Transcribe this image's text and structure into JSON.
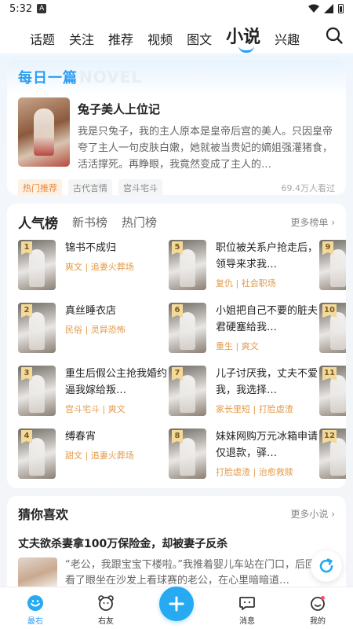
{
  "status": {
    "time": "5:32",
    "app_badge": "A"
  },
  "topnav": {
    "tabs": [
      {
        "label": "话题",
        "active": false
      },
      {
        "label": "关注",
        "active": false
      },
      {
        "label": "推荐",
        "active": false
      },
      {
        "label": "视频",
        "active": false
      },
      {
        "label": "图文",
        "active": false
      },
      {
        "label": "小说",
        "active": true
      },
      {
        "label": "兴趣",
        "active": false
      }
    ],
    "search_icon": "search-icon"
  },
  "daily": {
    "title": "每日一篇",
    "watermark": "NOVEL",
    "book_title": "兔子美人上位记",
    "description": "我是只兔子，我的主人原本是皇帝后宫的美人。只因皇帝夸了主人一句皮肤白嫩，她就被当贵妃的嫡姐强灌猪食，活活撑死。再睁眼，我竟然变成了主人的…",
    "tags": [
      "热门推荐",
      "古代言情",
      "宫斗宅斗"
    ],
    "reads": "69.4万人看过"
  },
  "rank": {
    "tabs": [
      {
        "label": "人气榜",
        "active": true
      },
      {
        "label": "新书榜",
        "active": false
      },
      {
        "label": "热门榜",
        "active": false
      }
    ],
    "more": "更多榜单 ›",
    "items": [
      {
        "num": "1",
        "title": "锦书不成归",
        "meta": "爽文 | 追妻火葬场"
      },
      {
        "num": "2",
        "title": "真丝睡衣店",
        "meta": "民俗 | 灵异恐怖"
      },
      {
        "num": "3",
        "title": "重生后假公主抢我婚约逼我嫁给叛…",
        "meta": "宫斗宅斗 | 爽文"
      },
      {
        "num": "4",
        "title": "缚春宵",
        "meta": "甜文 | 追妻火葬场"
      },
      {
        "num": "5",
        "title": "职位被关系户抢走后，领导来求我…",
        "meta": "复仇 | 社会职场"
      },
      {
        "num": "6",
        "title": "小姐把自己不要的脏夫君硬塞给我…",
        "meta": "重生 | 爽文"
      },
      {
        "num": "7",
        "title": "儿子讨厌我，丈夫不爱我，我选择…",
        "meta": "家长里短 | 打脸虐渣"
      },
      {
        "num": "8",
        "title": "妹妹网购万元冰箱申请仅退款，驿…",
        "meta": "打脸虐渣 | 治愈救赎"
      },
      {
        "num": "9",
        "title": "",
        "meta": ""
      },
      {
        "num": "10",
        "title": "",
        "meta": ""
      },
      {
        "num": "11",
        "title": "",
        "meta": ""
      },
      {
        "num": "12",
        "title": "",
        "meta": ""
      }
    ]
  },
  "guess": {
    "title": "猜你喜欢",
    "more": "更多小说 ›",
    "book_title": "丈夫欲杀妻拿100万保险金，却被妻子反杀",
    "description": "“老公，我跟宝宝下楼啦。”我推着婴儿车站在门口，后回头看了眼坐在沙发上看球赛的老公，在心里暗暗道…"
  },
  "bottom_nav": [
    {
      "label": "最右",
      "icon": "home-face-icon",
      "active": true
    },
    {
      "label": "右友",
      "icon": "friend-bear-icon",
      "active": false
    },
    {
      "label": "",
      "icon": "plus-icon",
      "active": false
    },
    {
      "label": "消息",
      "icon": "message-icon",
      "active": false
    },
    {
      "label": "我的",
      "icon": "profile-icon",
      "active": false
    }
  ],
  "colors": {
    "accent": "#27aaf1",
    "tag_hot": "#e9873a",
    "meta": "#e39a4a"
  }
}
